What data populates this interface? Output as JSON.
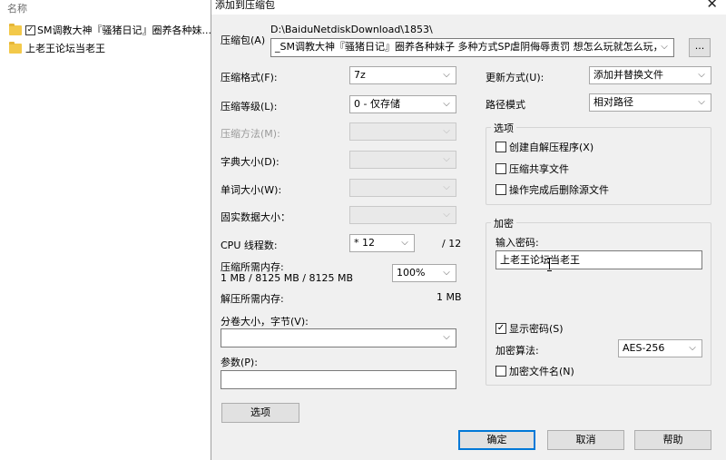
{
  "explorer": {
    "column_header": "名称",
    "rows": [
      {
        "label": "SM调教大神『骚猪日记』圈养各种妹...",
        "checked": true,
        "checkmark": "✓"
      },
      {
        "label": "上老王论坛当老王",
        "checked": false
      }
    ]
  },
  "dialog": {
    "title": "添加到压缩包",
    "close_glyph": "✕",
    "archive": {
      "label": "压缩包(A)",
      "path": "D:\\BaiduNetdiskDownload\\1853\\",
      "filename": "_SM调教大神『骚猪日记』圈养各种妹子 多种方式SP虐阴侮辱责罚 想怎么玩就怎么玩，ℓ",
      "browse_label": "..."
    },
    "format": {
      "label": "压缩格式(F):",
      "value": "7z"
    },
    "level": {
      "label": "压缩等级(L):",
      "value": "0 - 仅存储"
    },
    "method": {
      "label": "压缩方法(M):",
      "value": ""
    },
    "dict_size": {
      "label": "字典大小(D):",
      "value": ""
    },
    "word_size": {
      "label": "单词大小(W):",
      "value": ""
    },
    "solid_size": {
      "label": "固实数据大小：",
      "value": ""
    },
    "cpu_threads": {
      "label": "CPU 线程数:",
      "value": "* 12",
      "total": "/ 12"
    },
    "memory_compress": {
      "label": "压缩所需内存:",
      "detail": "1 MB / 8125 MB / 8125 MB",
      "value": "100%"
    },
    "memory_decompress": {
      "label": "解压所需内存:",
      "value": "1 MB"
    },
    "volume": {
      "label": "分卷大小，字节(V):",
      "value": ""
    },
    "params": {
      "label": "参数(P):",
      "value": ""
    },
    "options_button": "选项",
    "update_mode": {
      "label": "更新方式(U):",
      "value": "添加并替换文件"
    },
    "path_mode": {
      "label": "路径模式",
      "value": "相对路径"
    },
    "options_group": {
      "title": "选项",
      "sfx": {
        "label": "创建自解压程序(X)",
        "checked": false
      },
      "shared": {
        "label": "压缩共享文件",
        "checked": false
      },
      "delete_after": {
        "label": "操作完成后删除源文件",
        "checked": false
      }
    },
    "encryption": {
      "title": "加密",
      "password_label": "输入密码:",
      "password_value": "上老王论坛当老王",
      "show_password": {
        "label": "显示密码(S)",
        "checked": true,
        "checkmark": "✓"
      },
      "method_label": "加密算法:",
      "method_value": "AES-256",
      "encrypt_names": {
        "label": "加密文件名(N)",
        "checked": false
      }
    },
    "buttons": {
      "ok": "确定",
      "cancel": "取消",
      "help": "帮助"
    }
  }
}
